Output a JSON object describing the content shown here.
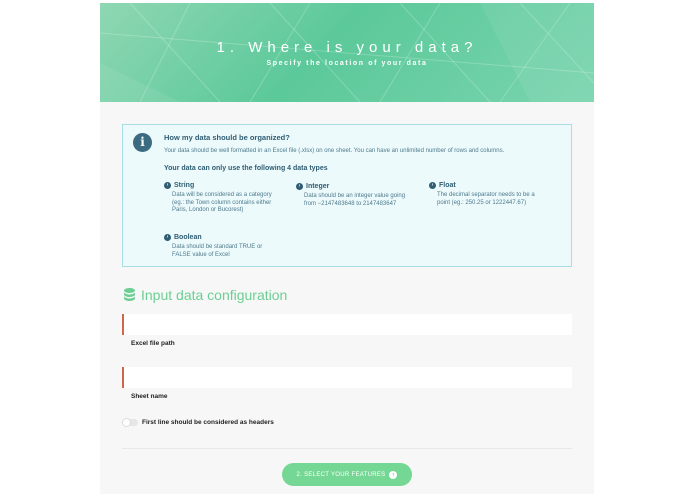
{
  "header": {
    "title": "1. Where is your data?",
    "subtitle": "Specify the location of your data"
  },
  "info_box": {
    "icon": "info-icon",
    "title": "How my data should be organized?",
    "description": "Your data should be well formatted in an Excel file (.xlsx) on one sheet. You can have an unlimited number of rows and columns.",
    "types_heading": "Your data can only use the following 4 data types",
    "types": [
      {
        "name": "String",
        "description": "Data will be considered as a category (eg.: the Town column contains either Paris, London or Bucorest)"
      },
      {
        "name": "Integer",
        "description": "Data should be an integer value going from −2147483648 to 2147483647"
      },
      {
        "name": "Float",
        "description": "The decimal separator needs to be a point (eg.: 250.25 or 1222447.67)"
      },
      {
        "name": "Boolean",
        "description": "Data should be standard TRUE or FALSE value of Excel"
      }
    ]
  },
  "config": {
    "section_title": "Input data configuration",
    "section_icon": "database-icon",
    "excel_path": {
      "label": "Excel file path",
      "value": ""
    },
    "sheet_name": {
      "label": "Sheet name",
      "value": ""
    },
    "headers_toggle": {
      "label": "First line should be considered as headers",
      "checked": false
    }
  },
  "actions": {
    "next_label": "2. SELECT YOUR FEATURES",
    "next_icon": "arrow-right-icon"
  },
  "colors": {
    "hero_green": "#5cc99a",
    "accent_green": "#74d894",
    "info_bg": "#ecfafc",
    "info_text": "#2f5d73",
    "field_border": "#d2664a"
  }
}
